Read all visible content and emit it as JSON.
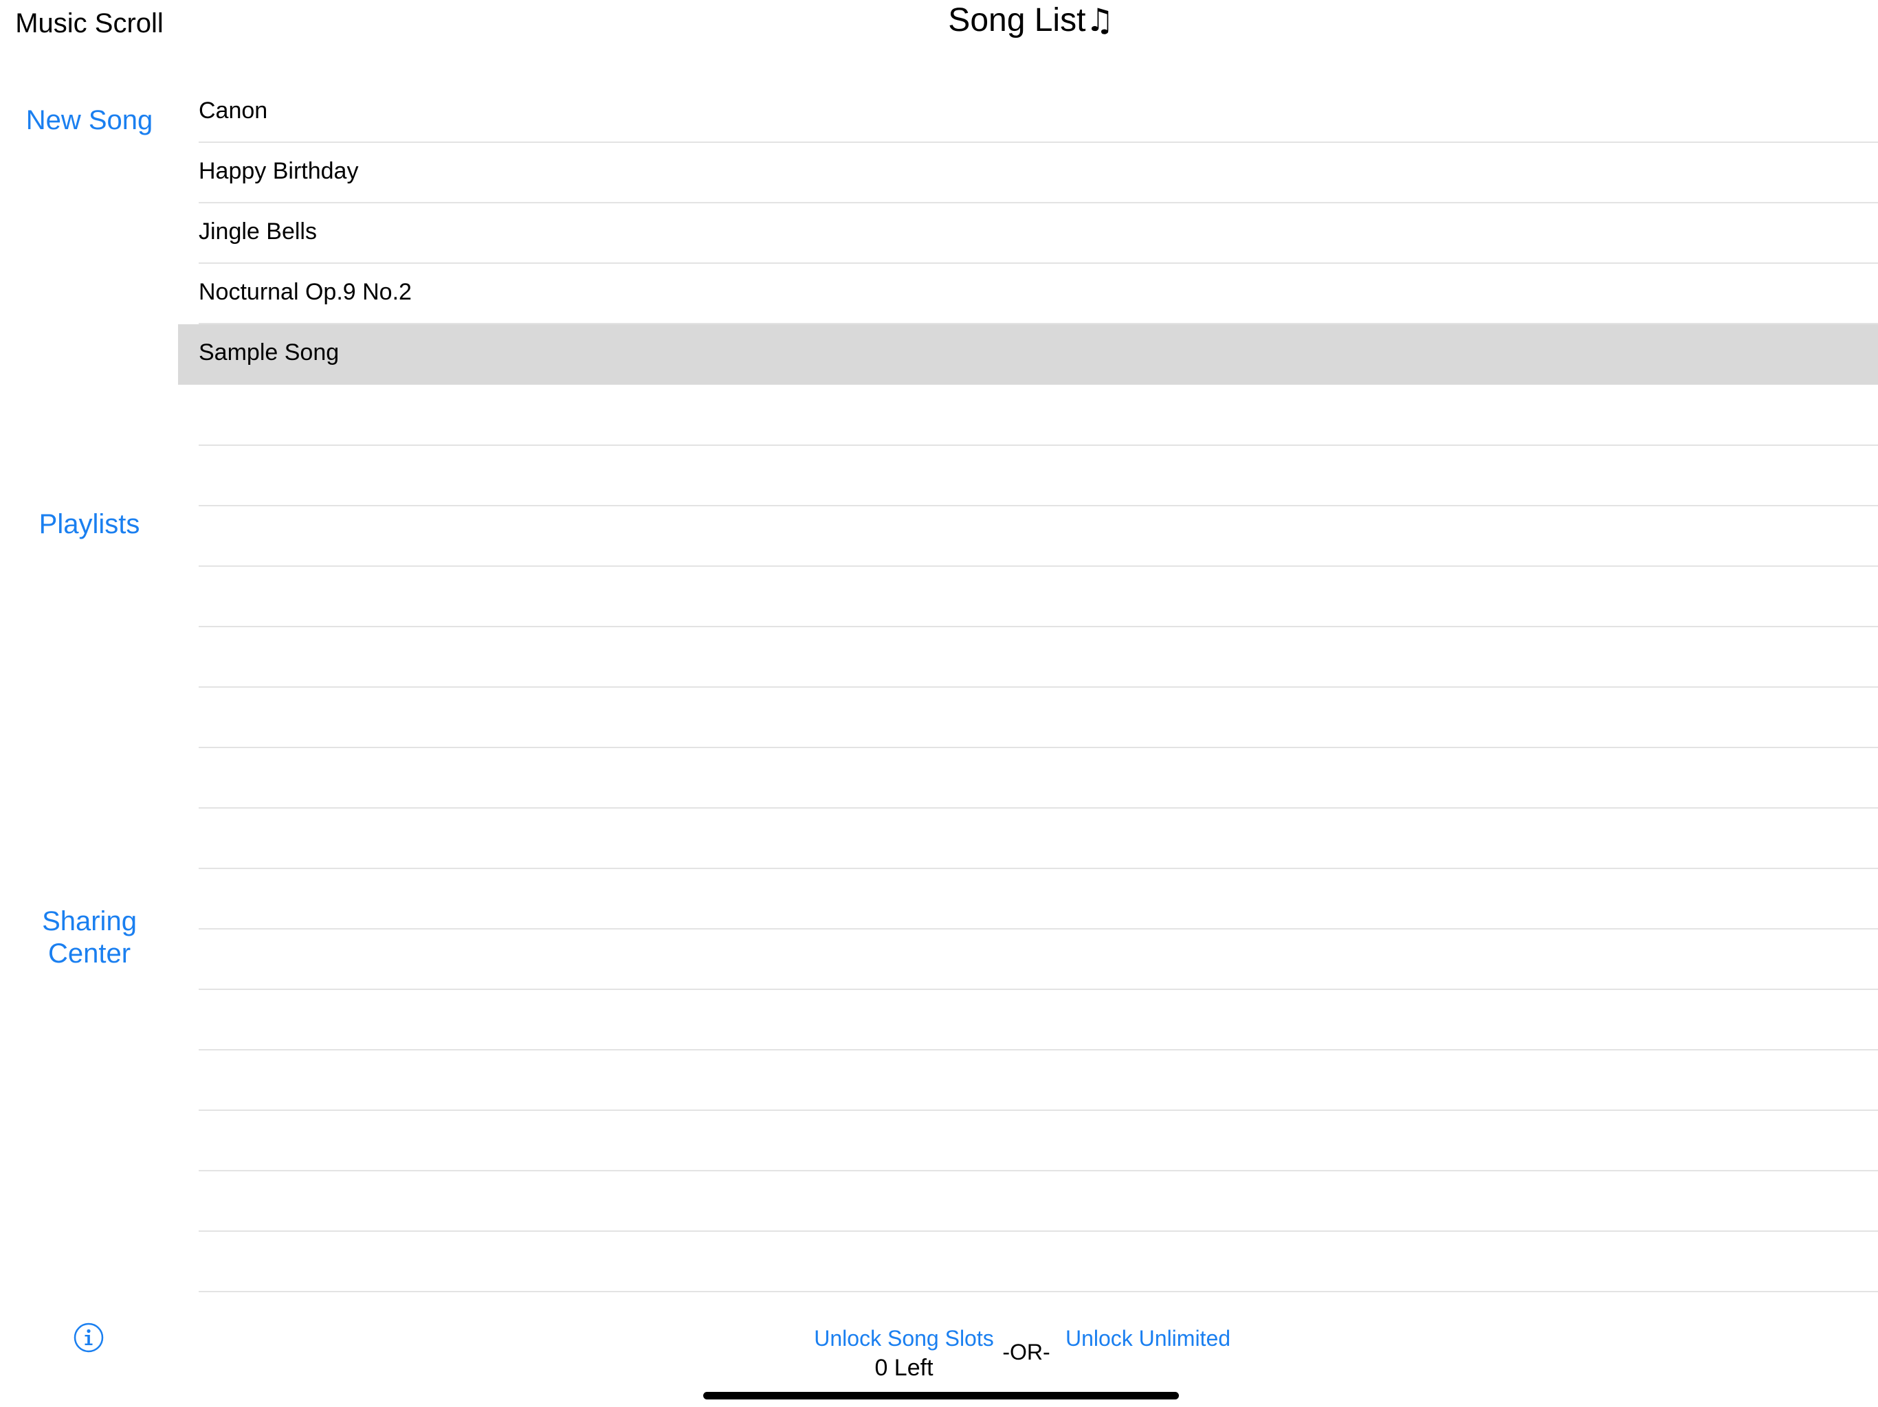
{
  "header": {
    "app_title": "Music Scroll",
    "page_title": "Song List",
    "page_title_icon": "♫"
  },
  "sidebar": {
    "new_song": "New Song",
    "playlists": "Playlists",
    "sharing_center_line1": "Sharing",
    "sharing_center_line2": "Center",
    "info_icon": "info-icon"
  },
  "songs": [
    {
      "title": "Canon",
      "selected": false
    },
    {
      "title": "Happy Birthday",
      "selected": false
    },
    {
      "title": "Jingle Bells",
      "selected": false
    },
    {
      "title": "Nocturnal Op.9 No.2",
      "selected": false
    },
    {
      "title": "Sample Song",
      "selected": true
    }
  ],
  "footer": {
    "unlock_slots": "Unlock Song Slots",
    "slots_left": "0 Left",
    "or_separator": "-OR-",
    "unlock_unlimited": "Unlock Unlimited"
  },
  "colors": {
    "accent": "#1a7ff0",
    "selected_row": "#d9d9d9",
    "separator": "#e3e3e3"
  }
}
